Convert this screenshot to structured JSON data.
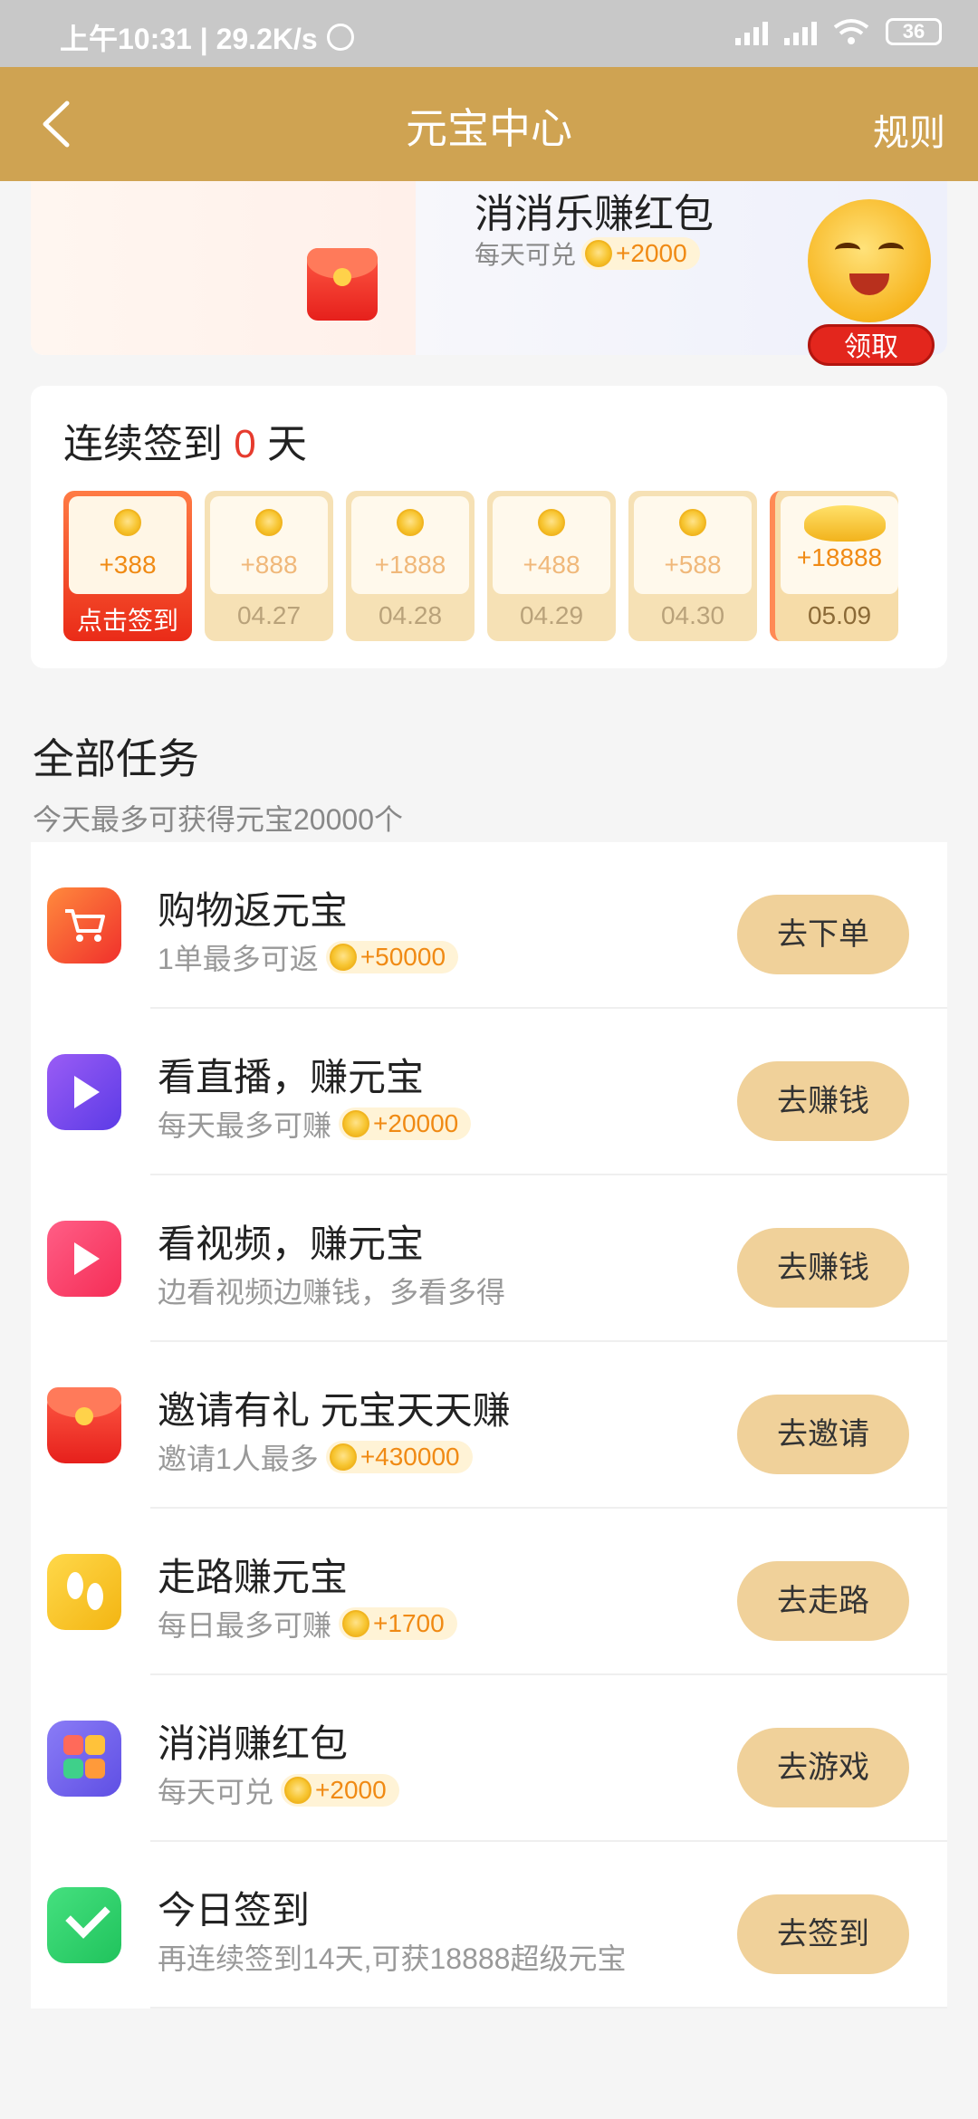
{
  "status_bar": {
    "time": "上午10:31 | 29.2K/s",
    "battery": "36"
  },
  "header": {
    "title": "元宝中心",
    "rules_label": "规则"
  },
  "banner": {
    "title": "消消乐赚红包",
    "subtitle": "每天可兑",
    "reward": "+2000",
    "claim_label": "领取"
  },
  "signin": {
    "title_prefix": "连续签到",
    "streak": "0",
    "title_suffix": "天",
    "days": [
      {
        "amount": "+388",
        "label": "点击签到"
      },
      {
        "amount": "+888",
        "label": "04.27"
      },
      {
        "amount": "+1888",
        "label": "04.28"
      },
      {
        "amount": "+488",
        "label": "04.29"
      },
      {
        "amount": "+588",
        "label": "04.30"
      },
      {
        "amount": "+18888",
        "label": "05.09"
      }
    ]
  },
  "tasks": {
    "title": "全部任务",
    "subtitle": "今天最多可获得元宝20000个",
    "items": [
      {
        "name": "购物返元宝",
        "desc": "1单最多可返",
        "reward": "+50000",
        "button": "去下单",
        "color": "#f4552d"
      },
      {
        "name": "看直播，赚元宝",
        "desc": "每天最多可赚",
        "reward": "+20000",
        "button": "去赚钱",
        "color": "#7b4df0"
      },
      {
        "name": "看视频，赚元宝",
        "desc": "边看视频边赚钱，多看多得",
        "reward": "",
        "button": "去赚钱",
        "color": "#ff3f6e"
      },
      {
        "name": "邀请有礼 元宝天天赚",
        "desc": "邀请1人最多",
        "reward": "+430000",
        "button": "去邀请",
        "color": "#ee2b22"
      },
      {
        "name": "走路赚元宝",
        "desc": "每日最多可赚",
        "reward": "+1700",
        "button": "去走路",
        "color": "#f7c21a"
      },
      {
        "name": "消消赚红包",
        "desc": "每天可兑",
        "reward": "+2000",
        "button": "去游戏",
        "color": "#7b68f0"
      },
      {
        "name": "今日签到",
        "desc": "再连续签到14天,可获18888超级元宝",
        "reward": "",
        "button": "去签到",
        "color": "#2fd46a"
      }
    ]
  }
}
